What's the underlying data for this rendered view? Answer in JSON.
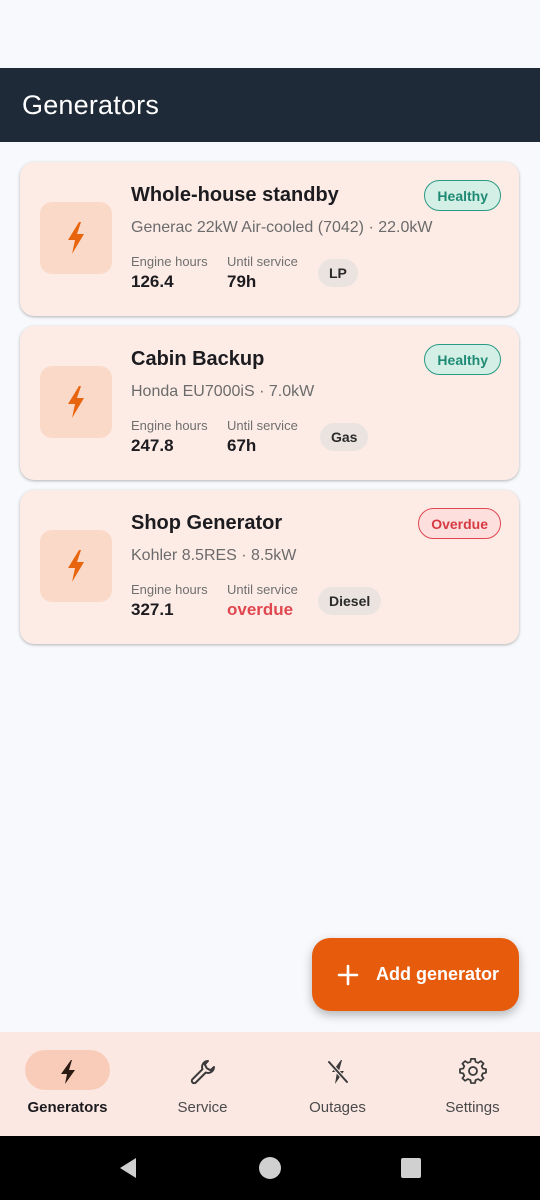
{
  "app_bar": {
    "title": "Generators"
  },
  "generators": [
    {
      "name": "Whole-house standby",
      "subtitle": "Generac 22kW Air-cooled (7042) · 22.0kW",
      "status": "Healthy",
      "engine_hours_label": "Engine hours",
      "engine_hours": "126.4",
      "until_service_label": "Until service",
      "until_service": "79h",
      "fuel": "LP"
    },
    {
      "name": "Cabin Backup",
      "subtitle": "Honda EU7000iS · 7.0kW",
      "status": "Healthy",
      "engine_hours_label": "Engine hours",
      "engine_hours": "247.8",
      "until_service_label": "Until service",
      "until_service": "67h",
      "fuel": "Gas"
    },
    {
      "name": "Shop Generator",
      "subtitle": "Kohler 8.5RES · 8.5kW",
      "status": "Overdue",
      "engine_hours_label": "Engine hours",
      "engine_hours": "327.1",
      "until_service_label": "Until service",
      "until_service": "overdue",
      "fuel": "Diesel"
    }
  ],
  "fab": {
    "label": "Add generator",
    "icon": "plus-icon"
  },
  "bottom_nav": [
    {
      "label": "Generators",
      "icon": "bolt-icon",
      "active": true
    },
    {
      "label": "Service",
      "icon": "wrench-icon",
      "active": false
    },
    {
      "label": "Outages",
      "icon": "flash-off-icon",
      "active": false
    },
    {
      "label": "Settings",
      "icon": "gear-icon",
      "active": false
    }
  ],
  "colors": {
    "app_bar": "#1e2a38",
    "accent": "#e65c0c",
    "card_bg": "#fdece6",
    "healthy": "#1f8b74",
    "overdue": "#e0474f"
  }
}
